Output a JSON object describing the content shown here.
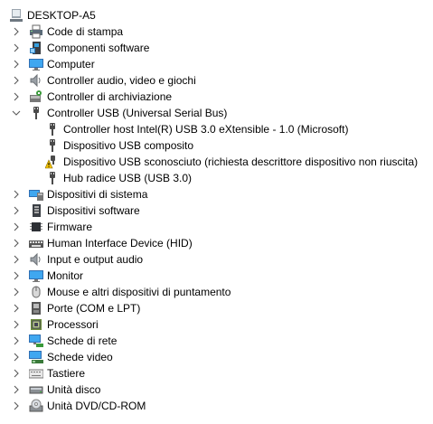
{
  "root": {
    "label": "DESKTOP-A5",
    "icon": "computer-icon"
  },
  "categories": [
    {
      "label": "Code di stampa",
      "icon": "printer-queue-icon",
      "expanded": false
    },
    {
      "label": "Componenti software",
      "icon": "software-component-icon",
      "expanded": false
    },
    {
      "label": "Computer",
      "icon": "monitor-icon",
      "expanded": false
    },
    {
      "label": "Controller audio, video e giochi",
      "icon": "speaker-icon",
      "expanded": false
    },
    {
      "label": "Controller di archiviazione",
      "icon": "storage-controller-icon",
      "expanded": false
    },
    {
      "label": "Controller USB (Universal Serial Bus)",
      "icon": "usb-icon",
      "expanded": true,
      "children": [
        {
          "label": "Controller host Intel(R) USB 3.0 eXtensible - 1.0 (Microsoft)",
          "icon": "usb-icon"
        },
        {
          "label": "Dispositivo USB composito",
          "icon": "usb-icon"
        },
        {
          "label": "Dispositivo USB sconosciuto (richiesta descrittore dispositivo non riuscita)",
          "icon": "usb-warning-icon"
        },
        {
          "label": "Hub radice USB (USB 3.0)",
          "icon": "usb-icon"
        }
      ]
    },
    {
      "label": "Dispositivi di sistema",
      "icon": "system-device-icon",
      "expanded": false
    },
    {
      "label": "Dispositivi software",
      "icon": "software-device-icon",
      "expanded": false
    },
    {
      "label": "Firmware",
      "icon": "firmware-chip-icon",
      "expanded": false
    },
    {
      "label": "Human Interface Device (HID)",
      "icon": "hid-keyboard-icon",
      "expanded": false
    },
    {
      "label": "Input e output audio",
      "icon": "speaker-icon",
      "expanded": false
    },
    {
      "label": "Monitor",
      "icon": "monitor-icon",
      "expanded": false
    },
    {
      "label": "Mouse e altri dispositivi di puntamento",
      "icon": "mouse-icon",
      "expanded": false
    },
    {
      "label": "Porte (COM e LPT)",
      "icon": "port-icon",
      "expanded": false
    },
    {
      "label": "Processori",
      "icon": "processor-icon",
      "expanded": false
    },
    {
      "label": "Schede di rete",
      "icon": "network-adapter-icon",
      "expanded": false
    },
    {
      "label": "Schede video",
      "icon": "display-adapter-icon",
      "expanded": false
    },
    {
      "label": "Tastiere",
      "icon": "keyboard-icon",
      "expanded": false
    },
    {
      "label": "Unità disco",
      "icon": "disk-drive-icon",
      "expanded": false
    },
    {
      "label": "Unità DVD/CD-ROM",
      "icon": "dvd-drive-icon",
      "expanded": false
    }
  ]
}
